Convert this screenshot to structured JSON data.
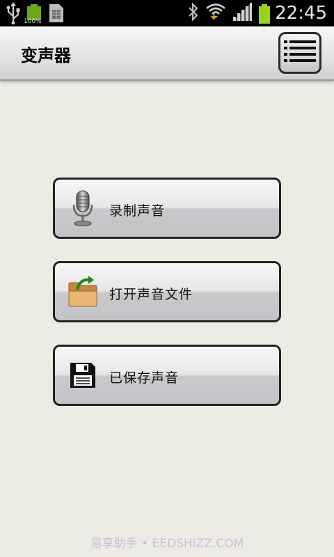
{
  "status_bar": {
    "time": "22:45",
    "battery_small_text": "100%",
    "icons": [
      "usb-icon",
      "battery-small-icon",
      "sim-card-icon",
      "bluetooth-icon",
      "wifi-icon",
      "signal-icon",
      "battery-icon"
    ],
    "battery_color": "#9bd21c"
  },
  "header": {
    "title": "变声器",
    "menu_icon": "list-menu-icon"
  },
  "buttons": [
    {
      "label": "录制声音",
      "icon": "microphone-icon"
    },
    {
      "label": "打开声音文件",
      "icon": "open-folder-icon"
    },
    {
      "label": "已保存声音",
      "icon": "floppy-disk-icon"
    }
  ],
  "watermark": "易享助手 • EEDSHIZZ.COM",
  "colors": {
    "background": "#ecebe3",
    "status_bar": "#000000",
    "accent_green": "#9bd21c"
  }
}
